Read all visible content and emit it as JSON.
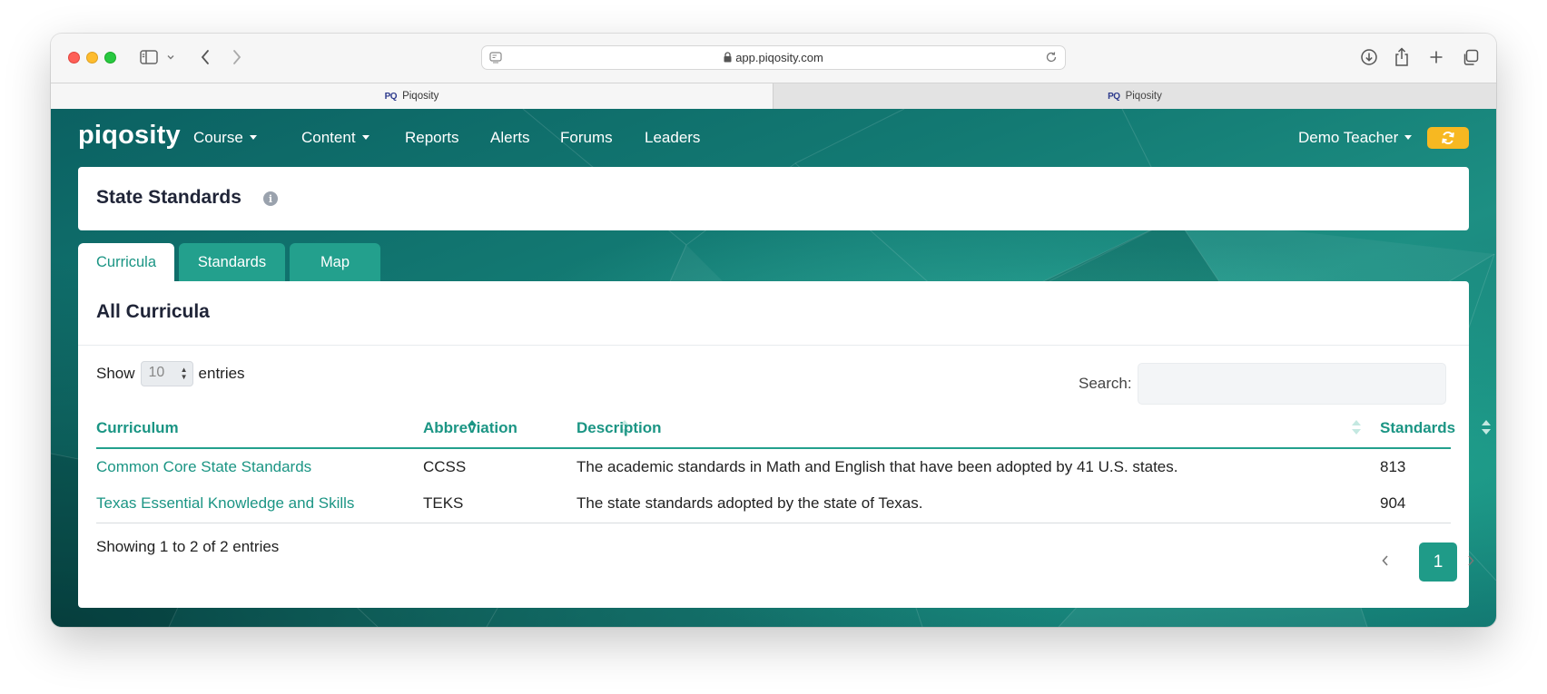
{
  "browser": {
    "url": "app.piqosity.com",
    "tabs": [
      {
        "favicon": "PQ",
        "title": "Piqosity"
      },
      {
        "favicon": "PQ",
        "title": "Piqosity"
      }
    ]
  },
  "navbar": {
    "brand": "piqosity",
    "items": [
      {
        "label": "Course"
      },
      {
        "label": "Content"
      },
      {
        "label": "Reports"
      },
      {
        "label": "Alerts"
      },
      {
        "label": "Forums"
      },
      {
        "label": "Leaders"
      }
    ],
    "user": "Demo Teacher",
    "sync_icon": "sync-icon"
  },
  "header": {
    "title": "State Standards",
    "info_icon": "i"
  },
  "page_tabs": [
    {
      "label": "Curricula",
      "active": true
    },
    {
      "label": "Standards",
      "active": false
    },
    {
      "label": "Map",
      "active": false
    }
  ],
  "card": {
    "title": "All Curricula",
    "length": {
      "show": "Show",
      "value": "10",
      "entries": "entries"
    },
    "search_label": "Search:",
    "search_value": "",
    "columns": [
      "Curriculum",
      "Abbreviation",
      "Description",
      "Standards"
    ],
    "rows": [
      {
        "curriculum": "Common Core State Standards",
        "abbreviation": "CCSS",
        "description": "The academic standards in Math and English that have been adopted by 41 U.S. states.",
        "standards": "813"
      },
      {
        "curriculum": "Texas Essential Knowledge and Skills",
        "abbreviation": "TEKS",
        "description": "The state standards adopted by the state of Texas.",
        "standards": "904"
      }
    ],
    "info": "Showing 1 to 2 of 2 entries",
    "pagination": {
      "current": "1"
    }
  },
  "colors": {
    "accent": "#1b9584",
    "tab_inactive": "#23a08d",
    "sync_button": "#f7b821"
  }
}
